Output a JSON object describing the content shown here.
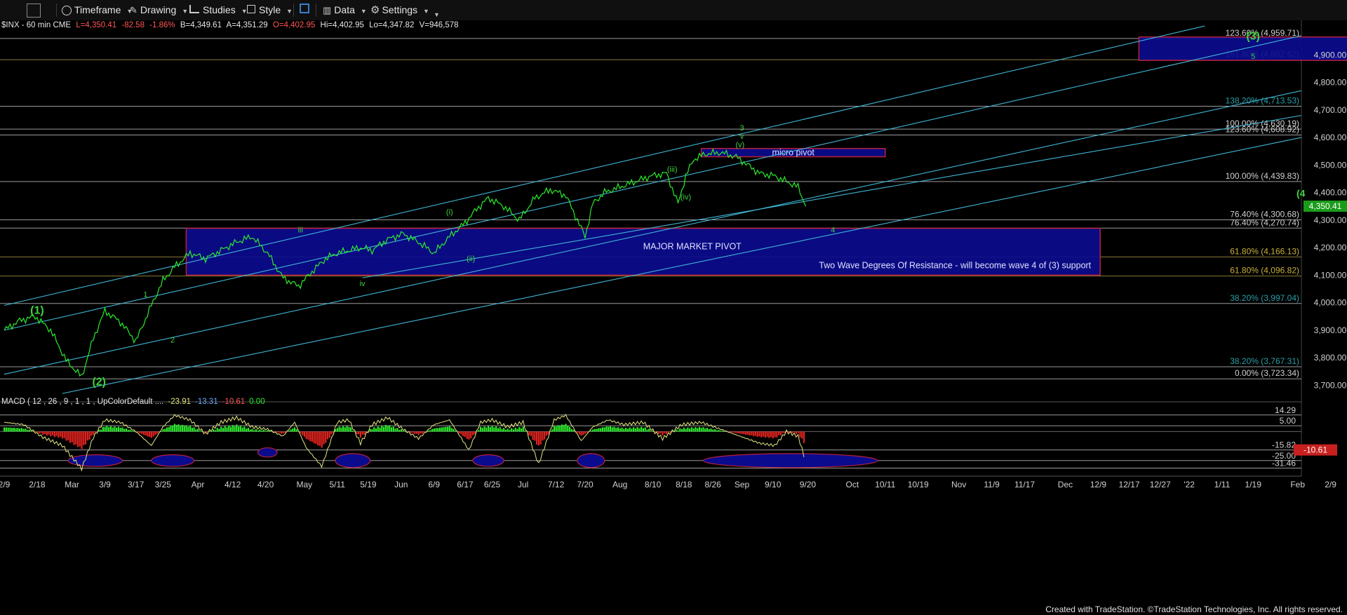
{
  "toolbar": {
    "timeframe": "Timeframe",
    "drawing": "Drawing",
    "studies": "Studies",
    "style": "Style",
    "data": "Data",
    "settings": "Settings"
  },
  "header": {
    "symbol": "$INX - 60 min  CME",
    "last": "L=4,350.41",
    "change": "-82.58",
    "pct": "-1.86%",
    "bid": "B=4,349.61",
    "ask": "A=4,351.29",
    "open": "O=4,402.95",
    "high": "Hi=4,402.95",
    "low": "Lo=4,347.82",
    "volume": "V=946,578"
  },
  "colors": {
    "price_line": "#2bea2b",
    "fib_line": "#b7b7b7",
    "fib_text": "#2a9fa8",
    "fib_text_white": "#d0d0d0",
    "channel": "#3fb6d6",
    "pivot_fill": "#0b0b8e",
    "pivot_border": "#b8213a",
    "wave_label": "#3ed23e",
    "macd_line": "#e6e680",
    "macd_hist_pos": "#2bea2b",
    "macd_hist_neg": "#e0231f",
    "last_price_bg": "#1a9b1a",
    "macd_badge_bg": "#c8201f"
  },
  "chart_data": {
    "type": "line",
    "title": "",
    "ylim": [
      3650,
      5000
    ],
    "y_ticks": [
      "4,900.00",
      "4,800.00",
      "4,700.00",
      "4,600.00",
      "4,500.00",
      "4,400.00",
      "4,300.00",
      "4,200.00",
      "4,100.00",
      "4,000.00",
      "3,900.00",
      "3,800.00",
      "3,700.00"
    ],
    "x_ticks": [
      "2/9",
      "2/18",
      "Mar",
      "3/9",
      "3/17",
      "3/25",
      "Apr",
      "4/12",
      "4/20",
      "May",
      "5/11",
      "5/19",
      "Jun",
      "6/9",
      "6/17",
      "6/25",
      "Jul",
      "7/12",
      "7/20",
      "Aug",
      "8/10",
      "8/18",
      "8/26",
      "Sep",
      "9/10",
      "9/20",
      "Oct",
      "10/11",
      "10/19",
      "Nov",
      "11/9",
      "11/17",
      "Dec",
      "12/9",
      "12/17",
      "12/27",
      "'22",
      "1/11",
      "1/19",
      "Feb",
      "2/9"
    ],
    "x_tick_index": [
      0,
      17,
      35,
      52,
      68,
      82,
      100,
      118,
      135,
      155,
      172,
      188,
      205,
      222,
      238,
      252,
      268,
      285,
      300,
      318,
      335,
      351,
      366,
      381,
      397,
      415,
      438,
      455,
      472,
      493,
      510,
      527,
      548,
      565,
      581,
      597,
      612,
      629,
      645,
      668,
      685
    ],
    "series": [
      {
        "values_index": [
          0,
          8,
          16,
          24,
          32,
          40,
          46,
          52,
          60,
          68,
          76,
          82,
          88,
          96,
          104,
          112,
          120,
          128,
          136,
          144,
          152,
          160,
          166,
          172,
          178,
          184,
          190,
          198,
          206,
          214,
          222,
          230,
          238,
          244,
          250,
          258,
          266,
          274,
          282,
          290,
          296,
          300,
          304,
          310,
          318,
          326,
          334,
          342,
          348,
          352,
          356,
          362,
          370,
          378,
          384,
          390,
          398,
          404,
          410,
          414
        ],
        "values": [
          3900,
          3935,
          3950,
          3900,
          3790,
          3730,
          3870,
          3970,
          3930,
          3860,
          3990,
          4080,
          4130,
          4180,
          4160,
          4190,
          4220,
          4240,
          4180,
          4090,
          4060,
          4120,
          4160,
          4180,
          4190,
          4200,
          4190,
          4230,
          4250,
          4220,
          4180,
          4240,
          4290,
          4340,
          4380,
          4350,
          4300,
          4380,
          4410,
          4390,
          4300,
          4240,
          4360,
          4400,
          4420,
          4440,
          4460,
          4470,
          4360,
          4460,
          4520,
          4540,
          4545,
          4530,
          4500,
          4470,
          4460,
          4440,
          4420,
          4350
        ]
      }
    ],
    "fib_levels": [
      {
        "label": "123.60% (4,959.71)",
        "value": 4959.71,
        "text_color": "fib_text_white"
      },
      {
        "label": "161.80% (4,882.62)",
        "value": 4882.62,
        "text_color": "fib_text_white",
        "line": "#8a7a3a"
      },
      {
        "label": "138.20% (4,713.53)",
        "value": 4713.53,
        "text_color": "fib_text"
      },
      {
        "label": "100.00% (4,630.19)",
        "value": 4630.19,
        "text_color": "fib_text_white"
      },
      {
        "label": "123.60% (4,608.92)",
        "value": 4608.92,
        "text_color": "fib_text_white"
      },
      {
        "label": "100.00% (4,439.83)",
        "value": 4439.83,
        "text_color": "fib_text_white"
      },
      {
        "label": "76.40% (4,300.68)",
        "value": 4300.68,
        "text_color": "fib_text_white"
      },
      {
        "label": "76.40% (4,270.74)",
        "value": 4270.74,
        "text_color": "fib_text_white"
      },
      {
        "label": "61.80% (4,166.13)",
        "value": 4166.13,
        "text_color": "#c8b03a",
        "line": "#8a7a3a"
      },
      {
        "label": "61.80% (4,096.82)",
        "value": 4096.82,
        "text_color": "#c8b03a",
        "line": "#8a7a3a"
      },
      {
        "label": "38.20% (3,997.04)",
        "value": 3997.04,
        "text_color": "fib_text"
      },
      {
        "label": "38.20% (3,767.31)",
        "value": 3767.31,
        "text_color": "fib_text"
      },
      {
        "label": "0.00% (3,723.34)",
        "value": 3723.34,
        "text_color": "fib_text_white"
      }
    ],
    "pivots": [
      {
        "name": "micro pivot",
        "x0": 360,
        "x1": 455,
        "y0": 4560,
        "y1": 4530
      },
      {
        "name": "MAJOR MARKET PIVOT",
        "x0": 94,
        "x1": 566,
        "y0": 4270,
        "y1": 4100,
        "note": "Two Wave Degrees Of Resistance - will become wave 4 of (3) support"
      },
      {
        "name": "",
        "x0": 586,
        "x1": 695,
        "y0": 4965,
        "y1": 4880
      }
    ],
    "wave_labels": [
      {
        "text": "(1)",
        "x": 17,
        "y": 3960,
        "big": true
      },
      {
        "text": "(2)",
        "x": 49,
        "y": 3700,
        "big": true
      },
      {
        "text": "1",
        "x": 73,
        "y": 4020
      },
      {
        "text": "2",
        "x": 87,
        "y": 3855
      },
      {
        "text": "iii",
        "x": 153,
        "y": 4255
      },
      {
        "text": "iv",
        "x": 185,
        "y": 4060
      },
      {
        "text": "(i)",
        "x": 230,
        "y": 4320
      },
      {
        "text": "(ii)",
        "x": 241,
        "y": 4150
      },
      {
        "text": "(iii)",
        "x": 345,
        "y": 4475
      },
      {
        "text": "(iv)",
        "x": 352,
        "y": 4375
      },
      {
        "text": "(v)",
        "x": 380,
        "y": 4565
      },
      {
        "text": "v",
        "x": 381,
        "y": 4595
      },
      {
        "text": "3",
        "x": 381,
        "y": 4625
      },
      {
        "text": "4",
        "x": 428,
        "y": 4255
      },
      {
        "text": "(3)",
        "x": 645,
        "y": 4955,
        "big": true
      },
      {
        "text": "5",
        "x": 645,
        "y": 4885
      }
    ],
    "channels": [
      {
        "x0": 0,
        "y0": 3990,
        "x1": 620,
        "y1": 5005
      },
      {
        "x0": 0,
        "y0": 3900,
        "x1": 690,
        "y1": 4970
      },
      {
        "x0": 0,
        "y0": 3740,
        "x1": 690,
        "y1": 4770
      },
      {
        "x0": 30,
        "y0": 3670,
        "x1": 690,
        "y1": 4600
      },
      {
        "x0": 185,
        "y0": 4090,
        "x1": 690,
        "y1": 4680
      }
    ],
    "last_price": "4,350.41",
    "right_edge_label": "(4",
    "macd": {
      "header": "MACD ( 12 , 26 , 9 , 1 , 1 , UpColorDefault ....",
      "v1": "-23.91",
      "v2": "-13.31",
      "v3": "-10.61",
      "v4": "0.00",
      "level_labels": [
        "14.29",
        "5.00",
        "-15.82",
        "-25.00",
        "-31.46"
      ],
      "level_values": [
        14.29,
        5.0,
        -15.82,
        -25.0,
        -31.46
      ],
      "badge": "-10.61",
      "ylim": [
        -36,
        22
      ],
      "line_index": [
        0,
        10,
        20,
        30,
        40,
        46,
        52,
        60,
        68,
        76,
        82,
        88,
        96,
        104,
        112,
        120,
        128,
        136,
        144,
        150,
        156,
        164,
        172,
        178,
        184,
        190,
        198,
        206,
        214,
        222,
        230,
        240,
        246,
        252,
        260,
        268,
        276,
        284,
        290,
        298,
        304,
        312,
        320,
        330,
        340,
        350,
        360,
        370,
        380,
        390,
        398,
        404,
        410,
        414
      ],
      "line": [
        8,
        6,
        -5,
        -12,
        -32,
        -5,
        10,
        8,
        0,
        -12,
        4,
        14,
        10,
        -2,
        8,
        12,
        4,
        2,
        -4,
        8,
        -14,
        -30,
        8,
        10,
        -10,
        6,
        12,
        2,
        -6,
        6,
        10,
        -16,
        8,
        10,
        4,
        8,
        -28,
        10,
        14,
        -8,
        4,
        10,
        6,
        8,
        -6,
        6,
        8,
        2,
        -4,
        -10,
        -12,
        0,
        -4,
        -26
      ],
      "ellipses": [
        {
          "x": 47,
          "y": -25,
          "rx": 14,
          "ry": 5
        },
        {
          "x": 87,
          "y": -25,
          "rx": 11,
          "ry": 5
        },
        {
          "x": 136,
          "y": -18,
          "rx": 5,
          "ry": 4
        },
        {
          "x": 180,
          "y": -25,
          "rx": 9,
          "ry": 6
        },
        {
          "x": 250,
          "y": -25,
          "rx": 8,
          "ry": 5
        },
        {
          "x": 303,
          "y": -25,
          "rx": 7,
          "ry": 6
        },
        {
          "x": 406,
          "y": -25,
          "rx": 45,
          "ry": 6
        }
      ]
    }
  },
  "footer": "Created with TradeStation. ©TradeStation Technologies, Inc. All rights reserved."
}
